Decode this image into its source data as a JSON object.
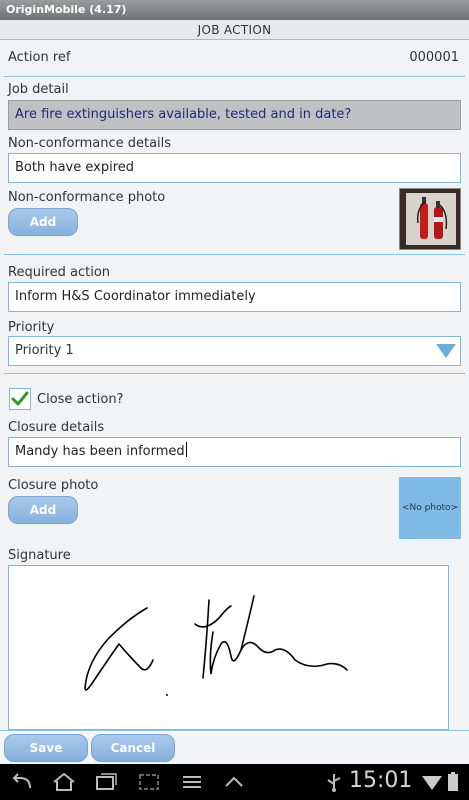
{
  "app": {
    "title": "OriginMobile (4.17)"
  },
  "header": {
    "title": "JOB ACTION"
  },
  "form": {
    "action_ref_label": "Action ref",
    "action_ref_value": "000001",
    "job_detail_label": "Job detail",
    "job_detail_value": "Are fire extinguishers available, tested and in date?",
    "nonconf_details_label": "Non-conformance details",
    "nonconf_details_value": "Both have expired",
    "nonconf_photo_label": "Non-conformance photo",
    "add_label": "Add",
    "required_action_label": "Required action",
    "required_action_value": "Inform H&S Coordinator immediately",
    "priority_label": "Priority",
    "priority_value": "Priority 1",
    "close_action_label": "Close action?",
    "close_action_checked": true,
    "closure_details_label": "Closure details",
    "closure_details_value": "Mandy has been informed",
    "closure_photo_label": "Closure photo",
    "closure_photo_placeholder": "<No photo>",
    "signature_label": "Signature"
  },
  "footer": {
    "save_label": "Save",
    "cancel_label": "Cancel"
  },
  "system": {
    "clock": "15:01"
  },
  "colors": {
    "accent": "#8fc3e3",
    "button": "#9bbde6",
    "readonly_text": "#1d2b7a"
  }
}
